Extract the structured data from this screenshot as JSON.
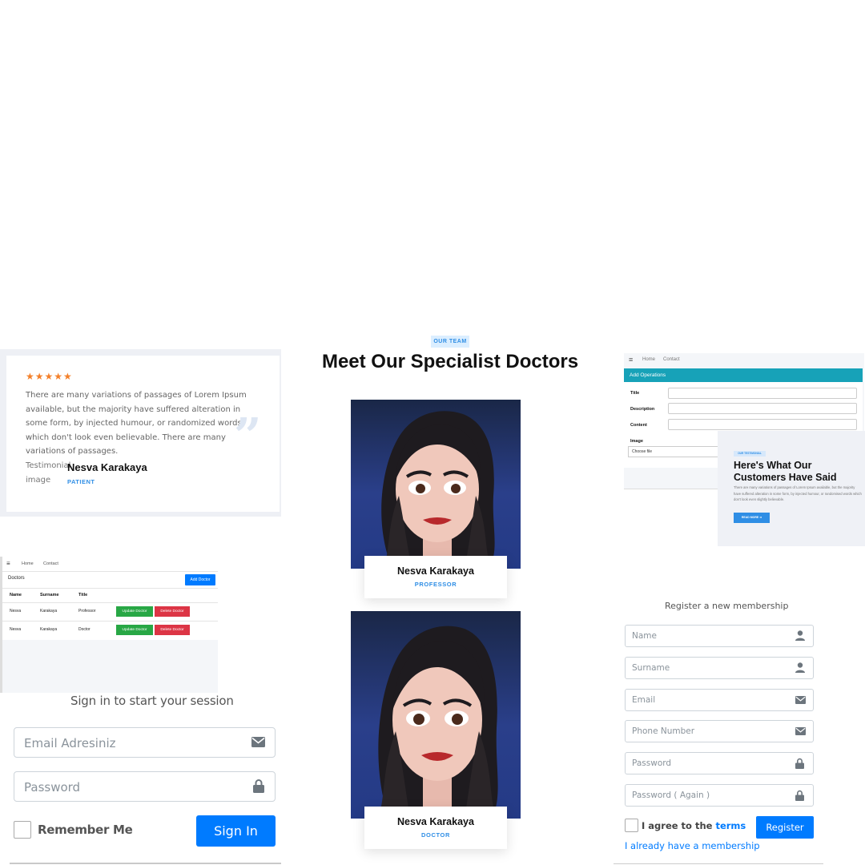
{
  "testimonial": {
    "stars": "★★★★★",
    "text": "There are many variations of passages of Lorem Ipsum available, but the majority have suffered alteration in some form, by injected humour, or randomized words which don't look even believable. There are many variations of passages.",
    "image_alt": "Testimonial image",
    "name": "Nesva Karakaya",
    "role": "PATIENT",
    "star_color": "#f4802a",
    "icons": [
      "star-icon",
      "quote-icon"
    ]
  },
  "team": {
    "badge": "OUR TEAM",
    "title": "Meet Our Specialist Doctors",
    "doctors": [
      {
        "name": "Nesva Karakaya",
        "role": "PROFESSOR"
      },
      {
        "name": "Nesva Karakaya",
        "role": "DOCTOR"
      }
    ],
    "accent_color": "#2f8ee5"
  },
  "operations": {
    "nav": {
      "home": "Home",
      "contact": "Contact"
    },
    "header": "Add Operations",
    "fields": [
      "Title",
      "Description",
      "Content"
    ],
    "image_label": "Image",
    "file_button": "Choose file",
    "header_color": "#17a2b8"
  },
  "customers": {
    "badge": "OUR TESTIMONIAL",
    "title": "Here's What Our Customers Have Said",
    "text": "There are many variations of passages of Lorem Ipsum available, but the majority have suffered alteration in some form, by injected humour, or randomised words which don't look even slightly believable.",
    "button": "READ MORE  ➜"
  },
  "doctors_table": {
    "nav": {
      "home": "Home",
      "contact": "Contact"
    },
    "title": "Doctors",
    "add_button": "Add Doctor",
    "columns": [
      "Name",
      "Surname",
      "Title"
    ],
    "rows": [
      {
        "name": "Nesva",
        "surname": "Karakaya",
        "title": "Professor"
      },
      {
        "name": "Nesva",
        "surname": "Karakaya",
        "title": "Doctor"
      }
    ],
    "update_button": "Update Doctor",
    "delete_button": "Delete Doctor"
  },
  "signin": {
    "title": "Sign in to start your session",
    "email_placeholder": "Email Adresiniz",
    "password_placeholder": "Password",
    "remember": "Remember Me",
    "button": "Sign In",
    "icons": [
      "envelope-icon",
      "lock-icon"
    ]
  },
  "register": {
    "title": "Register a new membership",
    "fields": [
      {
        "placeholder": "Name",
        "icon": "user-icon"
      },
      {
        "placeholder": "Surname",
        "icon": "user-icon"
      },
      {
        "placeholder": "Email",
        "icon": "envelope-icon"
      },
      {
        "placeholder": "Phone Number",
        "icon": "envelope-icon"
      },
      {
        "placeholder": "Password",
        "icon": "lock-icon"
      },
      {
        "placeholder": "Password ( Again )",
        "icon": "lock-icon"
      }
    ],
    "agree_prefix": "I agree to the ",
    "agree_terms": "terms",
    "button": "Register",
    "login_link": "I already have a membership",
    "button_color": "#007bff"
  }
}
